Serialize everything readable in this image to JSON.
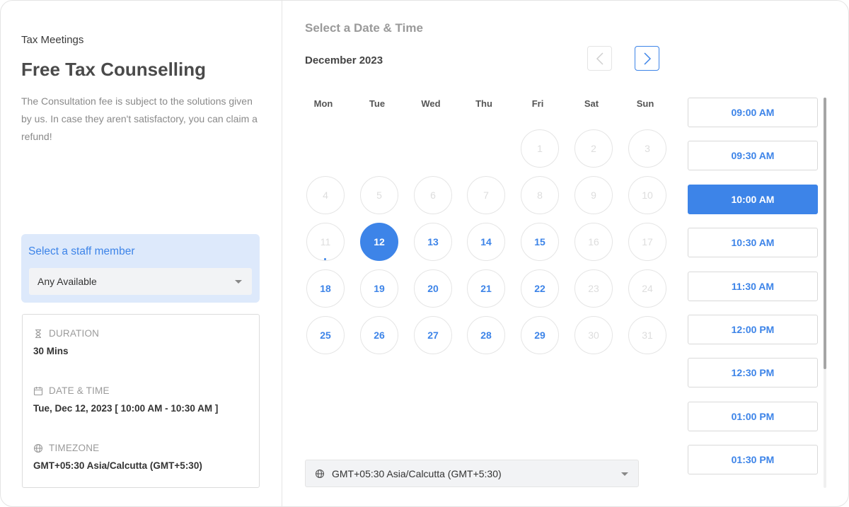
{
  "event": {
    "category": "Tax Meetings",
    "title": "Free Tax Counselling",
    "description": "The Consultation fee is subject to the solutions given by us. In case they aren't satisfactory, you can claim a refund!"
  },
  "staff": {
    "label": "Select a staff member",
    "selected": "Any Available"
  },
  "summary": {
    "duration_label": "DURATION",
    "duration_value": "30 Mins",
    "datetime_label": "DATE & TIME",
    "datetime_value": "Tue, Dec 12, 2023 [ 10:00 AM - 10:30 AM ]",
    "timezone_label": "TIMEZONE",
    "timezone_value": "GMT+05:30 Asia/Calcutta (GMT+5:30)"
  },
  "calendar": {
    "heading": "Select a Date & Time",
    "month": "December 2023",
    "weekdays": [
      "Mon",
      "Tue",
      "Wed",
      "Thu",
      "Fri",
      "Sat",
      "Sun"
    ],
    "weeks": [
      [
        "",
        "",
        "",
        "",
        "1",
        "2",
        "3"
      ],
      [
        "4",
        "5",
        "6",
        "7",
        "8",
        "9",
        "10"
      ],
      [
        "11",
        "12",
        "13",
        "14",
        "15",
        "16",
        "17"
      ],
      [
        "18",
        "19",
        "20",
        "21",
        "22",
        "23",
        "24"
      ],
      [
        "25",
        "26",
        "27",
        "28",
        "29",
        "30",
        "31"
      ]
    ],
    "available_days": [
      "12",
      "13",
      "14",
      "15",
      "18",
      "19",
      "20",
      "21",
      "22",
      "25",
      "26",
      "27",
      "28",
      "29"
    ],
    "selected_day": "12",
    "today": "11"
  },
  "timezone_select": "GMT+05:30 Asia/Calcutta (GMT+5:30)",
  "time_slots": [
    "09:00 AM",
    "09:30 AM",
    "10:00 AM",
    "10:30 AM",
    "11:30 AM",
    "12:00 PM",
    "12:30 PM",
    "01:00 PM",
    "01:30 PM"
  ],
  "selected_slot": "10:00 AM",
  "colors": {
    "accent": "#3d84e8",
    "staff_bg": "#dde9fb",
    "disabled_text": "#dddddd"
  },
  "icons": {
    "prev": "chevron-left-icon",
    "next": "chevron-right-icon",
    "duration": "hourglass-icon",
    "datetime": "calendar-icon",
    "timezone": "globe-icon",
    "dropdown": "caret-down-icon"
  }
}
